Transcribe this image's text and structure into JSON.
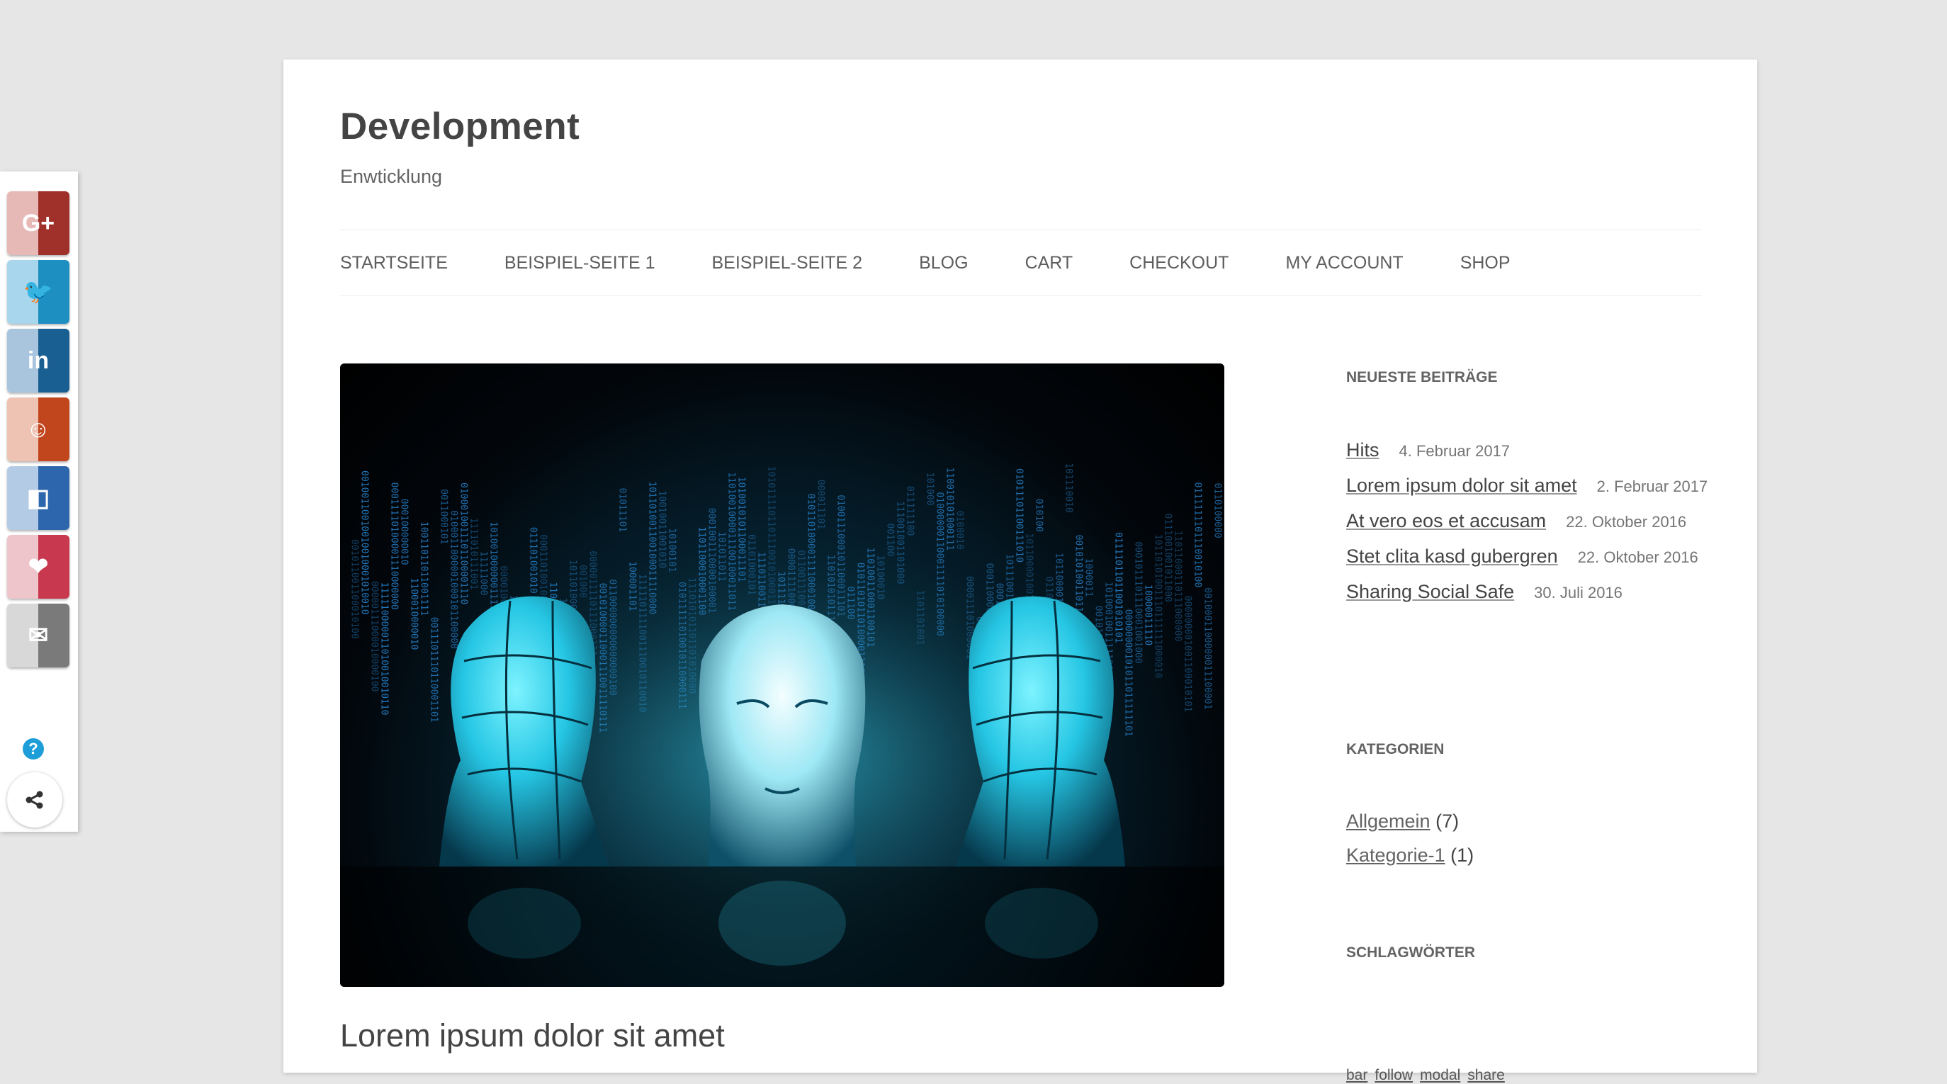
{
  "site": {
    "title": "Development",
    "description": "Enwticklung"
  },
  "nav": {
    "items": [
      "STARTSEITE",
      "BEISPIEL-SEITE 1",
      "BEISPIEL-SEITE 2",
      "BLOG",
      "CART",
      "CHECKOUT",
      "MY ACCOUNT",
      "SHOP"
    ]
  },
  "post": {
    "title": "Lorem ipsum dolor sit amet"
  },
  "sidebar": {
    "recent_title": "NEUESTE BEITRÄGE",
    "recent_posts": [
      {
        "title": "Hits",
        "date": "4. Februar 2017"
      },
      {
        "title": "Lorem ipsum dolor sit amet",
        "date": "2. Februar 2017"
      },
      {
        "title": "At vero eos et accusam",
        "date": "22. Oktober 2016"
      },
      {
        "title": "Stet clita kasd gubergren",
        "date": "22. Oktober 2016"
      },
      {
        "title": "Sharing Social Safe",
        "date": "30. Juli 2016"
      }
    ],
    "categories_title": "KATEGORIEN",
    "categories": [
      {
        "name": "Allgemein",
        "count": "(7)"
      },
      {
        "name": "Kategorie-1",
        "count": "(1)"
      }
    ],
    "tags_title": "SCHLAGWÖRTER",
    "tags": [
      "bar",
      "follow",
      "modal",
      "share"
    ]
  },
  "sharebar": {
    "buttons": [
      {
        "icon": "google-plus-icon",
        "glyph": "G+",
        "color_light": "#e6b9b7",
        "color_dark": "#a0302a"
      },
      {
        "icon": "twitter-icon",
        "glyph": "🐦",
        "color_light": "#a8d6ec",
        "color_dark": "#1d8fc1"
      },
      {
        "icon": "linkedin-icon",
        "glyph": "in",
        "color_light": "#a8c5dd",
        "color_dark": "#1a5f92"
      },
      {
        "icon": "reddit-icon",
        "glyph": "☺",
        "color_light": "#eec3b3",
        "color_dark": "#c2461d"
      },
      {
        "icon": "delicious-icon",
        "glyph": "◧",
        "color_light": "#b4cbe6",
        "color_dark": "#2e66ad"
      },
      {
        "icon": "pocket-icon",
        "glyph": "❤",
        "color_light": "#efc5cc",
        "color_dark": "#c8384e"
      },
      {
        "icon": "mail-icon",
        "glyph": "✉",
        "color_light": "#d8d8d8",
        "color_dark": "#7a7a7a"
      }
    ],
    "help_glyph": "?"
  }
}
